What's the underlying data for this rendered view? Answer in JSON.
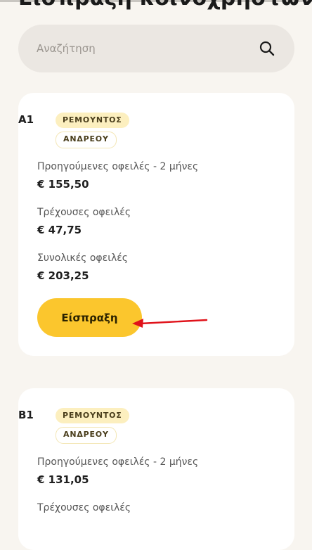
{
  "page": {
    "title": "Είσπραξη κοινοχρήστων"
  },
  "search": {
    "placeholder": "Αναζήτηση",
    "icon": "search-icon"
  },
  "cards": [
    {
      "unit": "Α1",
      "owner_line1": "ΡΕΜΟΥΝΤΟΣ",
      "owner_line2": "ΑΝΔΡΕΟΥ",
      "previous_label": "Προηγούμενες οφειλές - 2 μήνες",
      "previous_value": "€ 155,50",
      "current_label": "Τρέχουσες οφειλές",
      "current_value": "€ 47,75",
      "total_label": "Συνολικές οφειλές",
      "total_value": "€ 203,25",
      "button_label": "Είσπραξη"
    },
    {
      "unit": "Β1",
      "owner_line1": "ΡΕΜΟΥΝΤΟΣ",
      "owner_line2": "ΑΝΔΡΕΟΥ",
      "previous_label": "Προηγούμενες οφειλές - 2 μήνες",
      "previous_value": "€ 131,05",
      "current_label": "Τρέχουσες οφειλές"
    }
  ],
  "colors": {
    "background": "#f8f5f0",
    "card": "#ffffff",
    "accent": "#fbc62d",
    "badge": "#fcefbf",
    "annotation_arrow": "#e0121a"
  }
}
